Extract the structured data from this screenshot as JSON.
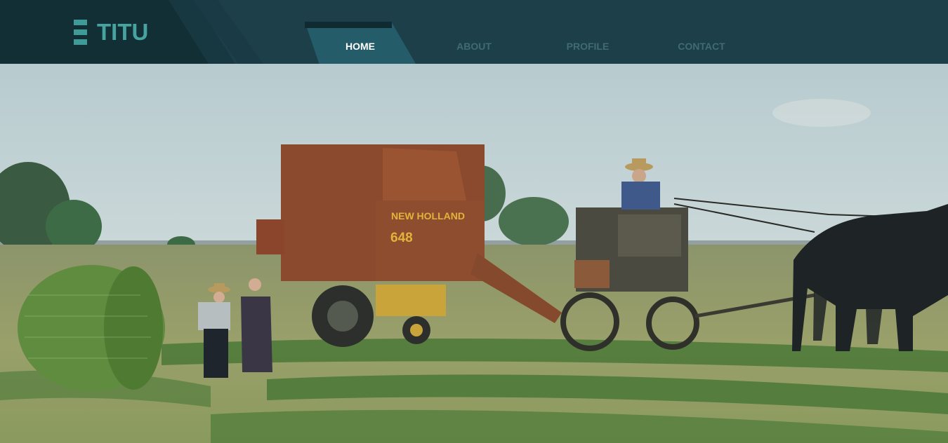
{
  "brand": {
    "name": "TITU",
    "logo_icon": "stacked-bars-icon"
  },
  "nav": {
    "items": [
      {
        "label": "HOME",
        "active": true
      },
      {
        "label": "ABOUT",
        "active": false
      },
      {
        "label": "PROFILE",
        "active": false
      },
      {
        "label": "CONTACT",
        "active": false
      }
    ]
  },
  "hero": {
    "baler_brand": "NEW HOLLAND",
    "baler_model": "648"
  },
  "colors": {
    "header_bg": "#1d3f4a",
    "header_dark": "#132f36",
    "accent": "#47a3a0",
    "nav_active_bg": "#245c6a",
    "nav_inactive": "#3e6b74"
  }
}
